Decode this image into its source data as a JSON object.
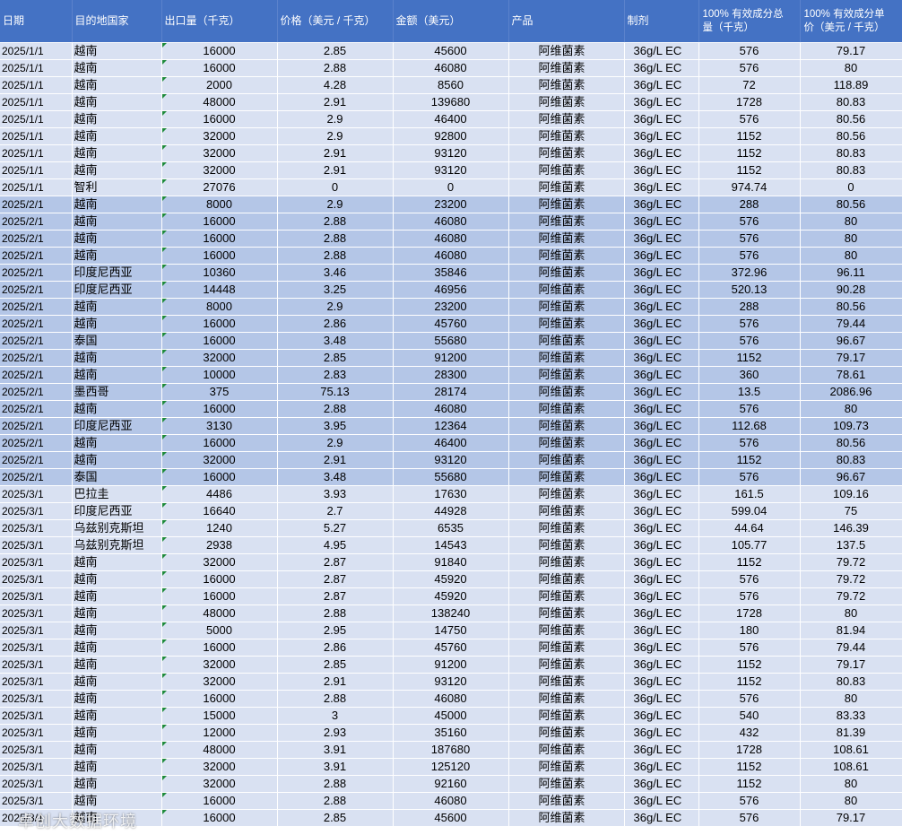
{
  "headers": {
    "date": "日期",
    "country": "目的地国家",
    "qty": "出口量（千克）",
    "price": "价格（美元 / 千克）",
    "amount": "金额（美元）",
    "product": "产品",
    "formulation": "制剂",
    "active_qty_line1": "100% 有效成分总",
    "active_qty_line2": "量（千克）",
    "active_price_line1": "100% 有效成分单",
    "active_price_line2": "价（美元 / 千克）"
  },
  "rows": [
    {
      "group": 1,
      "date": "2025/1/1",
      "country": "越南",
      "qty": "16000",
      "price": "2.85",
      "amount": "45600",
      "product": "阿维菌素",
      "formulation": "36g/L EC",
      "active_qty": "576",
      "active_price": "79.17"
    },
    {
      "group": 1,
      "date": "2025/1/1",
      "country": "越南",
      "qty": "16000",
      "price": "2.88",
      "amount": "46080",
      "product": "阿维菌素",
      "formulation": "36g/L EC",
      "active_qty": "576",
      "active_price": "80"
    },
    {
      "group": 1,
      "date": "2025/1/1",
      "country": "越南",
      "qty": "2000",
      "price": "4.28",
      "amount": "8560",
      "product": "阿维菌素",
      "formulation": "36g/L EC",
      "active_qty": "72",
      "active_price": "118.89"
    },
    {
      "group": 1,
      "date": "2025/1/1",
      "country": "越南",
      "qty": "48000",
      "price": "2.91",
      "amount": "139680",
      "product": "阿维菌素",
      "formulation": "36g/L EC",
      "active_qty": "1728",
      "active_price": "80.83"
    },
    {
      "group": 1,
      "date": "2025/1/1",
      "country": "越南",
      "qty": "16000",
      "price": "2.9",
      "amount": "46400",
      "product": "阿维菌素",
      "formulation": "36g/L EC",
      "active_qty": "576",
      "active_price": "80.56"
    },
    {
      "group": 1,
      "date": "2025/1/1",
      "country": "越南",
      "qty": "32000",
      "price": "2.9",
      "amount": "92800",
      "product": "阿维菌素",
      "formulation": "36g/L EC",
      "active_qty": "1152",
      "active_price": "80.56"
    },
    {
      "group": 1,
      "date": "2025/1/1",
      "country": "越南",
      "qty": "32000",
      "price": "2.91",
      "amount": "93120",
      "product": "阿维菌素",
      "formulation": "36g/L EC",
      "active_qty": "1152",
      "active_price": "80.83"
    },
    {
      "group": 1,
      "date": "2025/1/1",
      "country": "越南",
      "qty": "32000",
      "price": "2.91",
      "amount": "93120",
      "product": "阿维菌素",
      "formulation": "36g/L EC",
      "active_qty": "1152",
      "active_price": "80.83"
    },
    {
      "group": 1,
      "date": "2025/1/1",
      "country": "智利",
      "qty": "27076",
      "price": "0",
      "amount": "0",
      "product": "阿维菌素",
      "formulation": "36g/L EC",
      "active_qty": "974.74",
      "active_price": "0"
    },
    {
      "group": 2,
      "date": "2025/2/1",
      "country": "越南",
      "qty": "8000",
      "price": "2.9",
      "amount": "23200",
      "product": "阿维菌素",
      "formulation": "36g/L EC",
      "active_qty": "288",
      "active_price": "80.56"
    },
    {
      "group": 2,
      "date": "2025/2/1",
      "country": "越南",
      "qty": "16000",
      "price": "2.88",
      "amount": "46080",
      "product": "阿维菌素",
      "formulation": "36g/L EC",
      "active_qty": "576",
      "active_price": "80"
    },
    {
      "group": 2,
      "date": "2025/2/1",
      "country": "越南",
      "qty": "16000",
      "price": "2.88",
      "amount": "46080",
      "product": "阿维菌素",
      "formulation": "36g/L EC",
      "active_qty": "576",
      "active_price": "80"
    },
    {
      "group": 2,
      "date": "2025/2/1",
      "country": "越南",
      "qty": "16000",
      "price": "2.88",
      "amount": "46080",
      "product": "阿维菌素",
      "formulation": "36g/L EC",
      "active_qty": "576",
      "active_price": "80"
    },
    {
      "group": 2,
      "date": "2025/2/1",
      "country": "印度尼西亚",
      "qty": "10360",
      "price": "3.46",
      "amount": "35846",
      "product": "阿维菌素",
      "formulation": "36g/L EC",
      "active_qty": "372.96",
      "active_price": "96.11"
    },
    {
      "group": 2,
      "date": "2025/2/1",
      "country": "印度尼西亚",
      "qty": "14448",
      "price": "3.25",
      "amount": "46956",
      "product": "阿维菌素",
      "formulation": "36g/L EC",
      "active_qty": "520.13",
      "active_price": "90.28"
    },
    {
      "group": 2,
      "date": "2025/2/1",
      "country": "越南",
      "qty": "8000",
      "price": "2.9",
      "amount": "23200",
      "product": "阿维菌素",
      "formulation": "36g/L EC",
      "active_qty": "288",
      "active_price": "80.56"
    },
    {
      "group": 2,
      "date": "2025/2/1",
      "country": "越南",
      "qty": "16000",
      "price": "2.86",
      "amount": "45760",
      "product": "阿维菌素",
      "formulation": "36g/L EC",
      "active_qty": "576",
      "active_price": "79.44"
    },
    {
      "group": 2,
      "date": "2025/2/1",
      "country": "泰国",
      "qty": "16000",
      "price": "3.48",
      "amount": "55680",
      "product": "阿维菌素",
      "formulation": "36g/L EC",
      "active_qty": "576",
      "active_price": "96.67"
    },
    {
      "group": 2,
      "date": "2025/2/1",
      "country": "越南",
      "qty": "32000",
      "price": "2.85",
      "amount": "91200",
      "product": "阿维菌素",
      "formulation": "36g/L EC",
      "active_qty": "1152",
      "active_price": "79.17"
    },
    {
      "group": 2,
      "date": "2025/2/1",
      "country": "越南",
      "qty": "10000",
      "price": "2.83",
      "amount": "28300",
      "product": "阿维菌素",
      "formulation": "36g/L EC",
      "active_qty": "360",
      "active_price": "78.61"
    },
    {
      "group": 2,
      "date": "2025/2/1",
      "country": "墨西哥",
      "qty": "375",
      "price": "75.13",
      "amount": "28174",
      "product": "阿维菌素",
      "formulation": "36g/L EC",
      "active_qty": "13.5",
      "active_price": "2086.96"
    },
    {
      "group": 2,
      "date": "2025/2/1",
      "country": "越南",
      "qty": "16000",
      "price": "2.88",
      "amount": "46080",
      "product": "阿维菌素",
      "formulation": "36g/L EC",
      "active_qty": "576",
      "active_price": "80"
    },
    {
      "group": 2,
      "date": "2025/2/1",
      "country": "印度尼西亚",
      "qty": "3130",
      "price": "3.95",
      "amount": "12364",
      "product": "阿维菌素",
      "formulation": "36g/L EC",
      "active_qty": "112.68",
      "active_price": "109.73"
    },
    {
      "group": 2,
      "date": "2025/2/1",
      "country": "越南",
      "qty": "16000",
      "price": "2.9",
      "amount": "46400",
      "product": "阿维菌素",
      "formulation": "36g/L EC",
      "active_qty": "576",
      "active_price": "80.56"
    },
    {
      "group": 2,
      "date": "2025/2/1",
      "country": "越南",
      "qty": "32000",
      "price": "2.91",
      "amount": "93120",
      "product": "阿维菌素",
      "formulation": "36g/L EC",
      "active_qty": "1152",
      "active_price": "80.83"
    },
    {
      "group": 2,
      "date": "2025/2/1",
      "country": "泰国",
      "qty": "16000",
      "price": "3.48",
      "amount": "55680",
      "product": "阿维菌素",
      "formulation": "36g/L EC",
      "active_qty": "576",
      "active_price": "96.67"
    },
    {
      "group": 1,
      "date": "2025/3/1",
      "country": "巴拉圭",
      "qty": "4486",
      "price": "3.93",
      "amount": "17630",
      "product": "阿维菌素",
      "formulation": "36g/L EC",
      "active_qty": "161.5",
      "active_price": "109.16"
    },
    {
      "group": 1,
      "date": "2025/3/1",
      "country": "印度尼西亚",
      "qty": "16640",
      "price": "2.7",
      "amount": "44928",
      "product": "阿维菌素",
      "formulation": "36g/L EC",
      "active_qty": "599.04",
      "active_price": "75"
    },
    {
      "group": 1,
      "date": "2025/3/1",
      "country": "乌兹别克斯坦",
      "qty": "1240",
      "price": "5.27",
      "amount": "6535",
      "product": "阿维菌素",
      "formulation": "36g/L EC",
      "active_qty": "44.64",
      "active_price": "146.39"
    },
    {
      "group": 1,
      "date": "2025/3/1",
      "country": "乌兹别克斯坦",
      "qty": "2938",
      "price": "4.95",
      "amount": "14543",
      "product": "阿维菌素",
      "formulation": "36g/L EC",
      "active_qty": "105.77",
      "active_price": "137.5"
    },
    {
      "group": 1,
      "date": "2025/3/1",
      "country": "越南",
      "qty": "32000",
      "price": "2.87",
      "amount": "91840",
      "product": "阿维菌素",
      "formulation": "36g/L EC",
      "active_qty": "1152",
      "active_price": "79.72"
    },
    {
      "group": 1,
      "date": "2025/3/1",
      "country": "越南",
      "qty": "16000",
      "price": "2.87",
      "amount": "45920",
      "product": "阿维菌素",
      "formulation": "36g/L EC",
      "active_qty": "576",
      "active_price": "79.72"
    },
    {
      "group": 1,
      "date": "2025/3/1",
      "country": "越南",
      "qty": "16000",
      "price": "2.87",
      "amount": "45920",
      "product": "阿维菌素",
      "formulation": "36g/L EC",
      "active_qty": "576",
      "active_price": "79.72"
    },
    {
      "group": 1,
      "date": "2025/3/1",
      "country": "越南",
      "qty": "48000",
      "price": "2.88",
      "amount": "138240",
      "product": "阿维菌素",
      "formulation": "36g/L EC",
      "active_qty": "1728",
      "active_price": "80"
    },
    {
      "group": 1,
      "date": "2025/3/1",
      "country": "越南",
      "qty": "5000",
      "price": "2.95",
      "amount": "14750",
      "product": "阿维菌素",
      "formulation": "36g/L EC",
      "active_qty": "180",
      "active_price": "81.94"
    },
    {
      "group": 1,
      "date": "2025/3/1",
      "country": "越南",
      "qty": "16000",
      "price": "2.86",
      "amount": "45760",
      "product": "阿维菌素",
      "formulation": "36g/L EC",
      "active_qty": "576",
      "active_price": "79.44"
    },
    {
      "group": 1,
      "date": "2025/3/1",
      "country": "越南",
      "qty": "32000",
      "price": "2.85",
      "amount": "91200",
      "product": "阿维菌素",
      "formulation": "36g/L EC",
      "active_qty": "1152",
      "active_price": "79.17"
    },
    {
      "group": 1,
      "date": "2025/3/1",
      "country": "越南",
      "qty": "32000",
      "price": "2.91",
      "amount": "93120",
      "product": "阿维菌素",
      "formulation": "36g/L EC",
      "active_qty": "1152",
      "active_price": "80.83"
    },
    {
      "group": 1,
      "date": "2025/3/1",
      "country": "越南",
      "qty": "16000",
      "price": "2.88",
      "amount": "46080",
      "product": "阿维菌素",
      "formulation": "36g/L EC",
      "active_qty": "576",
      "active_price": "80"
    },
    {
      "group": 1,
      "date": "2025/3/1",
      "country": "越南",
      "qty": "15000",
      "price": "3",
      "amount": "45000",
      "product": "阿维菌素",
      "formulation": "36g/L EC",
      "active_qty": "540",
      "active_price": "83.33"
    },
    {
      "group": 1,
      "date": "2025/3/1",
      "country": "越南",
      "qty": "12000",
      "price": "2.93",
      "amount": "35160",
      "product": "阿维菌素",
      "formulation": "36g/L EC",
      "active_qty": "432",
      "active_price": "81.39"
    },
    {
      "group": 1,
      "date": "2025/3/1",
      "country": "越南",
      "qty": "48000",
      "price": "3.91",
      "amount": "187680",
      "product": "阿维菌素",
      "formulation": "36g/L EC",
      "active_qty": "1728",
      "active_price": "108.61"
    },
    {
      "group": 1,
      "date": "2025/3/1",
      "country": "越南",
      "qty": "32000",
      "price": "3.91",
      "amount": "125120",
      "product": "阿维菌素",
      "formulation": "36g/L EC",
      "active_qty": "1152",
      "active_price": "108.61"
    },
    {
      "group": 1,
      "date": "2025/3/1",
      "country": "越南",
      "qty": "32000",
      "price": "2.88",
      "amount": "92160",
      "product": "阿维菌素",
      "formulation": "36g/L EC",
      "active_qty": "1152",
      "active_price": "80"
    },
    {
      "group": 1,
      "date": "2025/3/1",
      "country": "越南",
      "qty": "16000",
      "price": "2.88",
      "amount": "46080",
      "product": "阿维菌素",
      "formulation": "36g/L EC",
      "active_qty": "576",
      "active_price": "80"
    },
    {
      "group": 1,
      "date": "2025/3/1",
      "country": "越南",
      "qty": "16000",
      "price": "2.85",
      "amount": "45600",
      "product": "阿维菌素",
      "formulation": "36g/L EC",
      "active_qty": "576",
      "active_price": "79.17"
    }
  ],
  "watermark": "卓创大数据环境",
  "colors": {
    "header_bg": "#4472c4",
    "row_light": "#d9e1f2",
    "row_dark": "#b4c6e7",
    "error_triangle": "#1e8a3c"
  }
}
